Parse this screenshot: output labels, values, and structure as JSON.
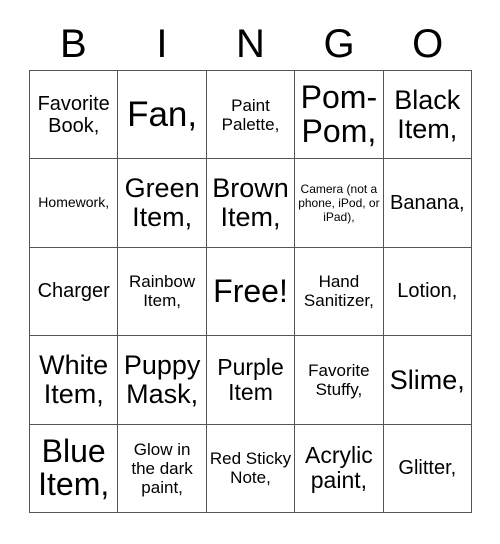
{
  "header": {
    "letters": [
      "B",
      "I",
      "N",
      "G",
      "O"
    ]
  },
  "grid": {
    "columns": 5,
    "rows": 5,
    "border_color": "#555555",
    "background_color": "#ffffff",
    "text_color": "#000000",
    "cells": [
      {
        "text": "Favorite Book,",
        "size": "fs-l",
        "name": "bingo-cell-b1"
      },
      {
        "text": "Fan,",
        "size": "fs-4xl",
        "name": "bingo-cell-i1"
      },
      {
        "text": "Paint Palette,",
        "size": "fs-m",
        "name": "bingo-cell-n1"
      },
      {
        "text": "Pom-Pom,",
        "size": "fs-3xl",
        "name": "bingo-cell-g1"
      },
      {
        "text": "Black Item,",
        "size": "fs-xxl",
        "name": "bingo-cell-o1"
      },
      {
        "text": "Homework,",
        "size": "fs-s",
        "name": "bingo-cell-b2"
      },
      {
        "text": "Green Item,",
        "size": "fs-xxl",
        "name": "bingo-cell-i2"
      },
      {
        "text": "Brown Item,",
        "size": "fs-xxl",
        "name": "bingo-cell-n2"
      },
      {
        "text": "Camera (not a phone, iPod, or iPad),",
        "size": "fs-xs",
        "name": "bingo-cell-g2"
      },
      {
        "text": "Banana,",
        "size": "fs-l",
        "name": "bingo-cell-o2"
      },
      {
        "text": "Charger",
        "size": "fs-l",
        "name": "bingo-cell-b3"
      },
      {
        "text": "Rainbow Item,",
        "size": "fs-m",
        "name": "bingo-cell-i3"
      },
      {
        "text": "Free!",
        "size": "fs-3xl",
        "name": "bingo-cell-n3-free"
      },
      {
        "text": "Hand Sanitizer,",
        "size": "fs-m",
        "name": "bingo-cell-g3"
      },
      {
        "text": "Lotion,",
        "size": "fs-l",
        "name": "bingo-cell-o3"
      },
      {
        "text": "White Item,",
        "size": "fs-xxl",
        "name": "bingo-cell-b4"
      },
      {
        "text": "Puppy Mask,",
        "size": "fs-xxl",
        "name": "bingo-cell-i4"
      },
      {
        "text": "Purple Item",
        "size": "fs-xl",
        "name": "bingo-cell-n4"
      },
      {
        "text": "Favorite Stuffy,",
        "size": "fs-m",
        "name": "bingo-cell-g4"
      },
      {
        "text": "Slime,",
        "size": "fs-xxl",
        "name": "bingo-cell-o4"
      },
      {
        "text": "Blue Item,",
        "size": "fs-3xl",
        "name": "bingo-cell-b5"
      },
      {
        "text": "Glow in the dark paint,",
        "size": "fs-m",
        "name": "bingo-cell-i5"
      },
      {
        "text": "Red Sticky Note,",
        "size": "fs-m",
        "name": "bingo-cell-n5"
      },
      {
        "text": "Acrylic paint,",
        "size": "fs-xl",
        "name": "bingo-cell-g5"
      },
      {
        "text": "Glitter,",
        "size": "fs-l",
        "name": "bingo-cell-o5"
      }
    ]
  }
}
